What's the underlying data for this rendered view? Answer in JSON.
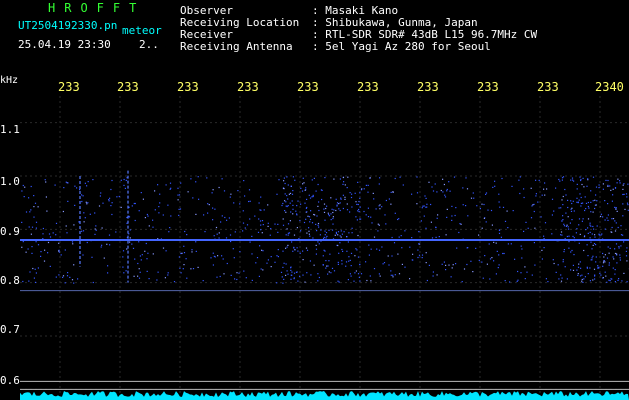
{
  "header": {
    "brand": "HROFFT",
    "filename": "UT2504192330.pn",
    "meteor_label": "meteor",
    "timestamp": "25.04.19 23:30",
    "count": "2..",
    "rows": [
      {
        "label": "Observer",
        "value": ": Masaki Kano"
      },
      {
        "label": "Receiving Location",
        "value": ": Shibukawa, Gunma, Japan"
      },
      {
        "label": "Receiver",
        "value": ": RTL-SDR SDR# 43dB L15 96.7MHz CW"
      },
      {
        "label": "Receiving Antenna",
        "value": ": 5el Yagi Az 280 for Seoul"
      }
    ]
  },
  "axis": {
    "y_unit": "kHz",
    "y_ticks": [
      "1.1",
      "1.0",
      "0.9",
      "0.8",
      "0.7",
      "0.6"
    ],
    "x_ticks": [
      "233",
      "233",
      "233",
      "233",
      "233",
      "233",
      "233",
      "233",
      "233",
      "2340"
    ]
  },
  "colors": {
    "background": "#000000",
    "grid": "#2a2a2a",
    "signal": "#3355ff",
    "noise_floor": "#00e5ff",
    "tick_label_x": "#ffff66"
  },
  "chart_data": {
    "type": "heatmap",
    "x_ticks": [
      "233",
      "233",
      "233",
      "233",
      "233",
      "233",
      "233",
      "233",
      "233",
      "2340"
    ],
    "y_unit": "kHz",
    "y_ticks": [
      "1.1",
      "1.0",
      "0.9",
      "0.8",
      "0.7",
      "0.6"
    ],
    "ylim": [
      0.58,
      1.15
    ],
    "carrier_khz": 0.88,
    "secondary_line_khz": 0.785,
    "signal_band_khz": [
      0.8,
      1.0
    ],
    "grid": true
  }
}
